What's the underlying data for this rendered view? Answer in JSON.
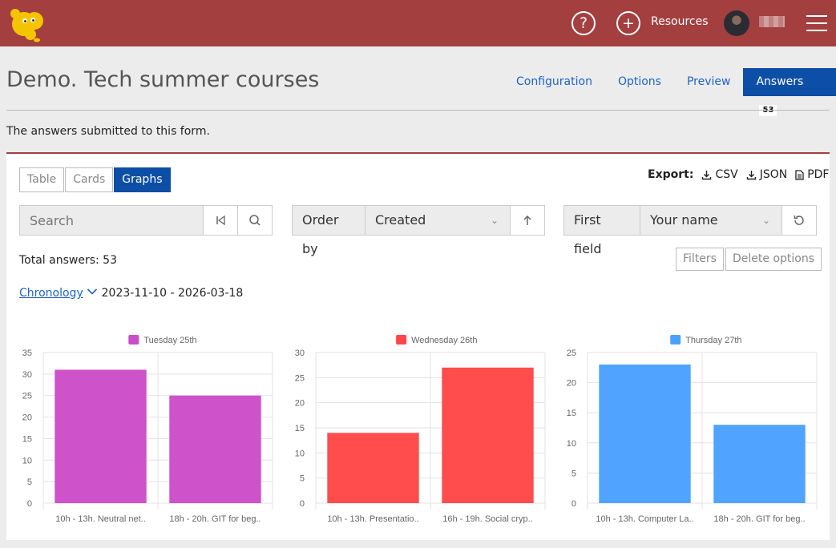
{
  "header": {
    "help_icon": "question-circle-icon",
    "add_icon": "plus-circle-icon",
    "resources_label": "Resources",
    "menu_icon": "hamburger-icon"
  },
  "page": {
    "title": "Demo. Tech summer courses",
    "description": "The answers submitted to this form."
  },
  "tabs": [
    {
      "label": "Configuration"
    },
    {
      "label": "Options"
    },
    {
      "label": "Preview"
    },
    {
      "label": "Answers",
      "badge": "53",
      "active": true
    }
  ],
  "view_toggle": [
    {
      "label": "Table"
    },
    {
      "label": "Cards"
    },
    {
      "label": "Graphs",
      "active": true
    }
  ],
  "export": {
    "label": "Export:",
    "items": [
      {
        "label": "CSV",
        "icon": "download-icon"
      },
      {
        "label": "JSON",
        "icon": "download-icon"
      },
      {
        "label": "PDF",
        "icon": "file-icon"
      }
    ]
  },
  "search": {
    "placeholder": "Search"
  },
  "order": {
    "label": "Order by",
    "value": "Created"
  },
  "first_field": {
    "label": "First field",
    "value": "Your name"
  },
  "total": "Total answers: 53",
  "buttons": {
    "filters": "Filters",
    "delete_options": "Delete options"
  },
  "chronology": {
    "label": "Chronology",
    "range": "2023-11-10 - 2026-03-18"
  },
  "colors": {
    "brand": "#a33f3f",
    "accent": "#0d4ea6",
    "series1": "#cc4cc8",
    "series2": "#ff4747",
    "series3": "#4aa1ff"
  },
  "chart_data": [
    {
      "type": "bar",
      "categories": [
        "10h - 13h. Neutral net..",
        "18h - 20h. GIT for beg.."
      ],
      "series": [
        {
          "name": "Tuesday 25th",
          "values": [
            31,
            25
          ]
        }
      ],
      "ylim": [
        0,
        35
      ],
      "yticks": [
        0,
        5,
        10,
        15,
        20,
        25,
        30,
        35
      ],
      "legend": "top",
      "color": "#cc4cc8"
    },
    {
      "type": "bar",
      "categories": [
        "10h - 13h. Presentatio..",
        "16h - 19h. Social cryp.."
      ],
      "series": [
        {
          "name": "Wednesday 26th",
          "values": [
            14,
            27
          ]
        }
      ],
      "ylim": [
        0,
        30
      ],
      "yticks": [
        0,
        5,
        10,
        15,
        20,
        25,
        30
      ],
      "legend": "top",
      "color": "#ff4747"
    },
    {
      "type": "bar",
      "categories": [
        "10h - 13h. Computer La..",
        "18h - 20h. GIT for beg.."
      ],
      "series": [
        {
          "name": "Thursday 27th",
          "values": [
            23,
            13
          ]
        }
      ],
      "ylim": [
        0,
        25
      ],
      "yticks": [
        0,
        5,
        10,
        15,
        20,
        25
      ],
      "legend": "top",
      "color": "#4aa1ff"
    }
  ]
}
